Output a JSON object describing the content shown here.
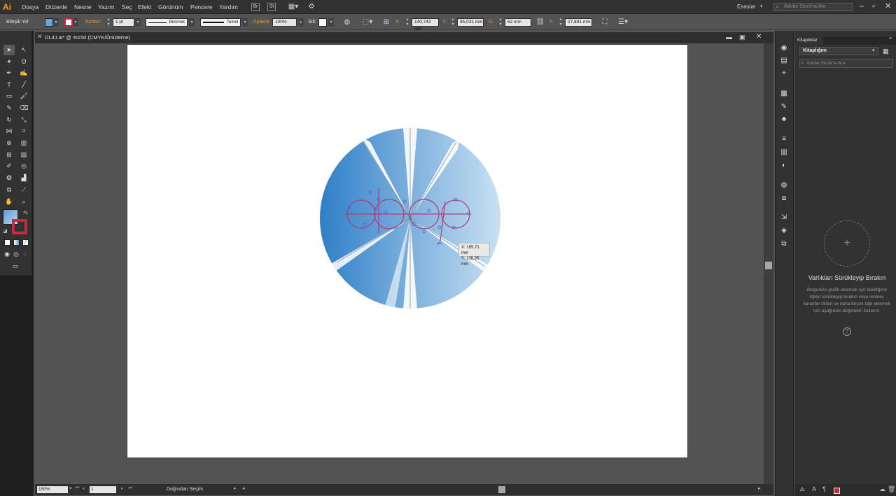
{
  "app": {
    "logo": "Ai"
  },
  "menu": [
    "Dosya",
    "Düzenle",
    "Nesne",
    "Yazım",
    "Seç",
    "Efekt",
    "Görünüm",
    "Pencere",
    "Yardım"
  ],
  "menu_buttons": {
    "bridge": "Br",
    "stock": "St"
  },
  "workspace": {
    "label": "Esaslar",
    "search_placeholder": "Adobe Stock'ta Ara"
  },
  "control_bar": {
    "selection_type": "Bileşik Yol",
    "stroke_label": "Kontur:",
    "stroke_weight": "1 pt",
    "stroke_profile": "Birörnek",
    "brush": "Temel",
    "opacity_label": "Opaklık:",
    "opacity_value": "100%",
    "style_label": "Stil:",
    "x_label": "X:",
    "x_value": "140,743 mm",
    "y_label": "Y:",
    "y_value": "95,031 mm",
    "w_label": "G:",
    "w_value": "62 mm",
    "h_label": "Y:",
    "h_value": "27,891 mm",
    "fill_color": "#6fa3d6",
    "stroke_color": "#d0263b"
  },
  "document": {
    "title": "DL4J.ai* @ %150 (CMYK/Önizleme)"
  },
  "status": {
    "zoom": "150%",
    "page": "1",
    "tool": "Doğrudan Seçim"
  },
  "tooltip": {
    "x": "X: 155,71 mm",
    "y": "Y: 108,95 mm"
  },
  "libraries": {
    "tab": "Kitaplıklar",
    "selected_library": "Kitaplığım",
    "search_placeholder": "Adobe Stock'ta Ara",
    "empty_title": "Varlıkları Sürükleyip Bırakın",
    "empty_desc": "Belgenize grafik eklemek için dilediğiniz öğeyi sürükleyip bırakın veya renkler, karakter stilleri ve daha birçok öğe eklemek için aşağıdaki düğmeleri kullanın."
  },
  "artwork": {
    "gradient_start": "#2f7fc7",
    "gradient_end": "#c9e1f2",
    "path_color": "#b03a7a",
    "anchor_color": "#4a63e0"
  }
}
